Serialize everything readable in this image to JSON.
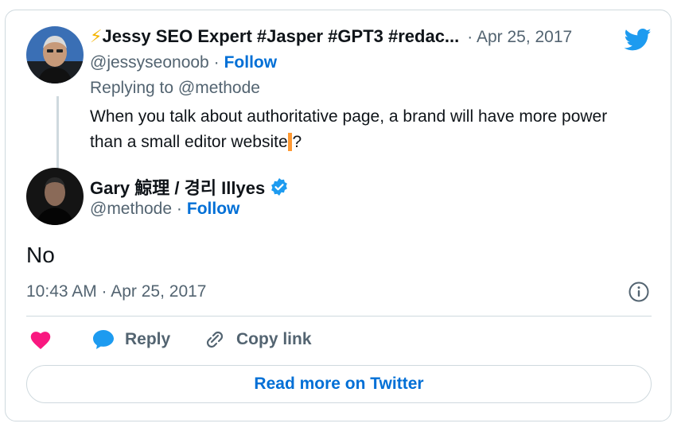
{
  "parent": {
    "emoji": "⚡",
    "display_name": "Jessy SEO Expert #Jasper #GPT3 #redac...",
    "date": "· Apr 25, 2017",
    "handle": "@jessyseonoob ·",
    "follow_label": "Follow",
    "replying_to": "Replying to @methode",
    "text_before": "When you talk about authoritative page, a brand will have more power than a small editor website",
    "highlight": "  ",
    "text_after": "?"
  },
  "reply": {
    "display_name": "Gary 鯨理 / 경리 Illyes",
    "handle": "@methode ·",
    "follow_label": "Follow",
    "text": "No",
    "timestamp": "10:43 AM · Apr 25, 2017"
  },
  "actions": {
    "reply_label": "Reply",
    "copy_link_label": "Copy link"
  },
  "read_more_label": "Read more on Twitter",
  "colors": {
    "twitter_blue": "#1d9bf0",
    "link_blue": "#006fd6",
    "like_pink": "#f91880",
    "highlight_orange": "#ff9932",
    "verified_blue": "#1d9bf0"
  }
}
